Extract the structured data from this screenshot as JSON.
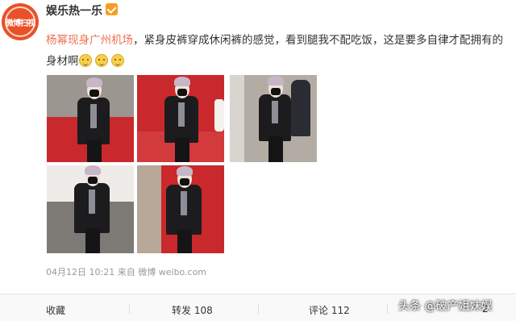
{
  "post": {
    "avatar_text": "微博扫视",
    "username": "娱乐热一乐",
    "content": {
      "tag": "杨幂现身广州机场",
      "text": "，紧身皮裤穿成休闲裤的感觉，看到腿我不配吃饭，这是要多自律才配拥有的身材啊",
      "emoji_name": "smile-emoji"
    },
    "photos": [
      {
        "name": "photo-1",
        "bg": "red"
      },
      {
        "name": "photo-2",
        "bg": "red"
      },
      {
        "name": "photo-3",
        "bg": "grey"
      },
      {
        "name": "photo-4",
        "bg": "grey"
      },
      {
        "name": "photo-5",
        "bg": "red"
      }
    ],
    "meta": {
      "date": "04月12日",
      "time": "10:21",
      "source": "来自 微博 weibo.com"
    }
  },
  "actions": {
    "favorite": "收藏",
    "repost": "转发 108",
    "comment": "评论 112",
    "like": "2"
  },
  "watermark": "头条 @破产姐妹娱"
}
